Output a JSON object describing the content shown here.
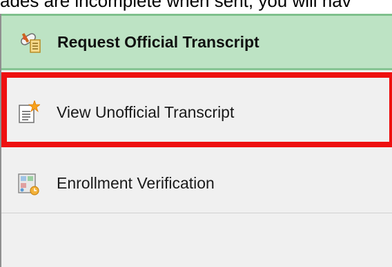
{
  "top_text": "ades are incomplete when sent, you will hav",
  "menu": {
    "items": [
      {
        "label": "Request Official Transcript",
        "icon": "diploma-scroll-icon",
        "selected": true
      },
      {
        "label": "View Unofficial Transcript",
        "icon": "document-star-icon",
        "selected": false
      },
      {
        "label": "Enrollment Verification",
        "icon": "verification-form-icon",
        "selected": false
      }
    ]
  },
  "colors": {
    "selected_background": "#bde3c4",
    "selected_border": "#7ec08c",
    "panel_background": "#f0f0f0",
    "highlight_box": "#ee1010"
  }
}
